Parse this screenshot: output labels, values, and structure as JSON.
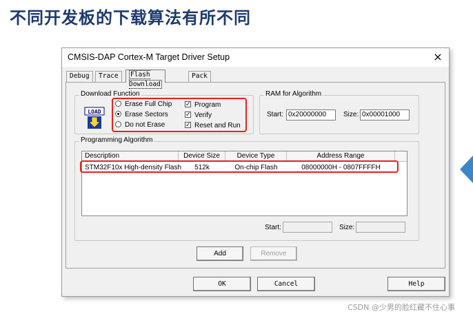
{
  "heading": "不同开发板的下载算法有所不同",
  "dialog": {
    "title": "CMSIS-DAP Cortex-M Target Driver Setup",
    "close_glyph": "×",
    "tabs": [
      {
        "label": "Debug"
      },
      {
        "label": "Trace"
      },
      {
        "label": "Flash Download"
      },
      {
        "label": "Pack"
      }
    ],
    "download_function": {
      "label": "Download Function",
      "icon_text": "LOAD",
      "erase_options": [
        "Erase Full Chip",
        "Erase Sectors",
        "Do not Erase"
      ],
      "erase_selected": "Erase Sectors",
      "checks": [
        "Program",
        "Verify",
        "Reset and Run"
      ]
    },
    "ram": {
      "label": "RAM for Algorithm",
      "start_label": "Start:",
      "start_value": "0x20000000",
      "size_label": "Size:",
      "size_value": "0x00001000"
    },
    "programming": {
      "label": "Programming Algorithm",
      "columns": [
        "Description",
        "Device Size",
        "Device Type",
        "Address Range"
      ],
      "rows": [
        [
          "STM32F10x High-density Flash",
          "512k",
          "On-chip Flash",
          "08000000H - 0807FFFFH"
        ]
      ],
      "start_label": "Start:",
      "size_label": "Size:",
      "add_label": "Add",
      "remove_label": "Remove"
    },
    "buttons": {
      "ok": "OK",
      "cancel": "Cancel",
      "help": "Help"
    }
  },
  "watermark": "CSDN @少男的脸红藏不住心事",
  "colors": {
    "highlight": "#e8201c",
    "heading": "#1e3a6e",
    "arrow": "#3a86c8"
  }
}
